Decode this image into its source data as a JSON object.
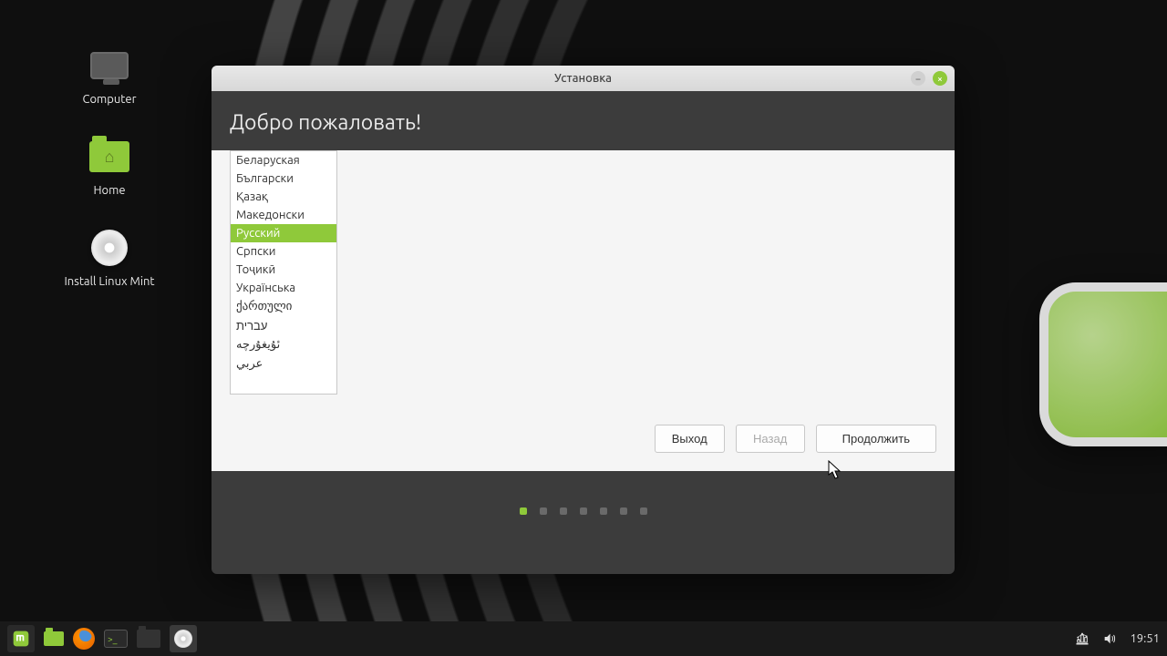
{
  "desktop": {
    "icons": {
      "computer": "Computer",
      "home": "Home",
      "install": "Install Linux Mint"
    }
  },
  "installer": {
    "title": "Установка",
    "welcome": "Добро пожаловать!",
    "languages": [
      "Беларуская",
      "Български",
      "Қазақ",
      "Македонски",
      "Русский",
      "Српски",
      "Тоҷикӣ",
      "Українська",
      "ქართული",
      "עברית",
      "ئۇيغۇرچە",
      "عربي"
    ],
    "selected_language_index": 4,
    "buttons": {
      "quit": "Выход",
      "back": "Назад",
      "continue": "Продолжить"
    },
    "pager": {
      "total": 7,
      "active": 0
    }
  },
  "taskbar": {
    "clock": "19:51"
  }
}
